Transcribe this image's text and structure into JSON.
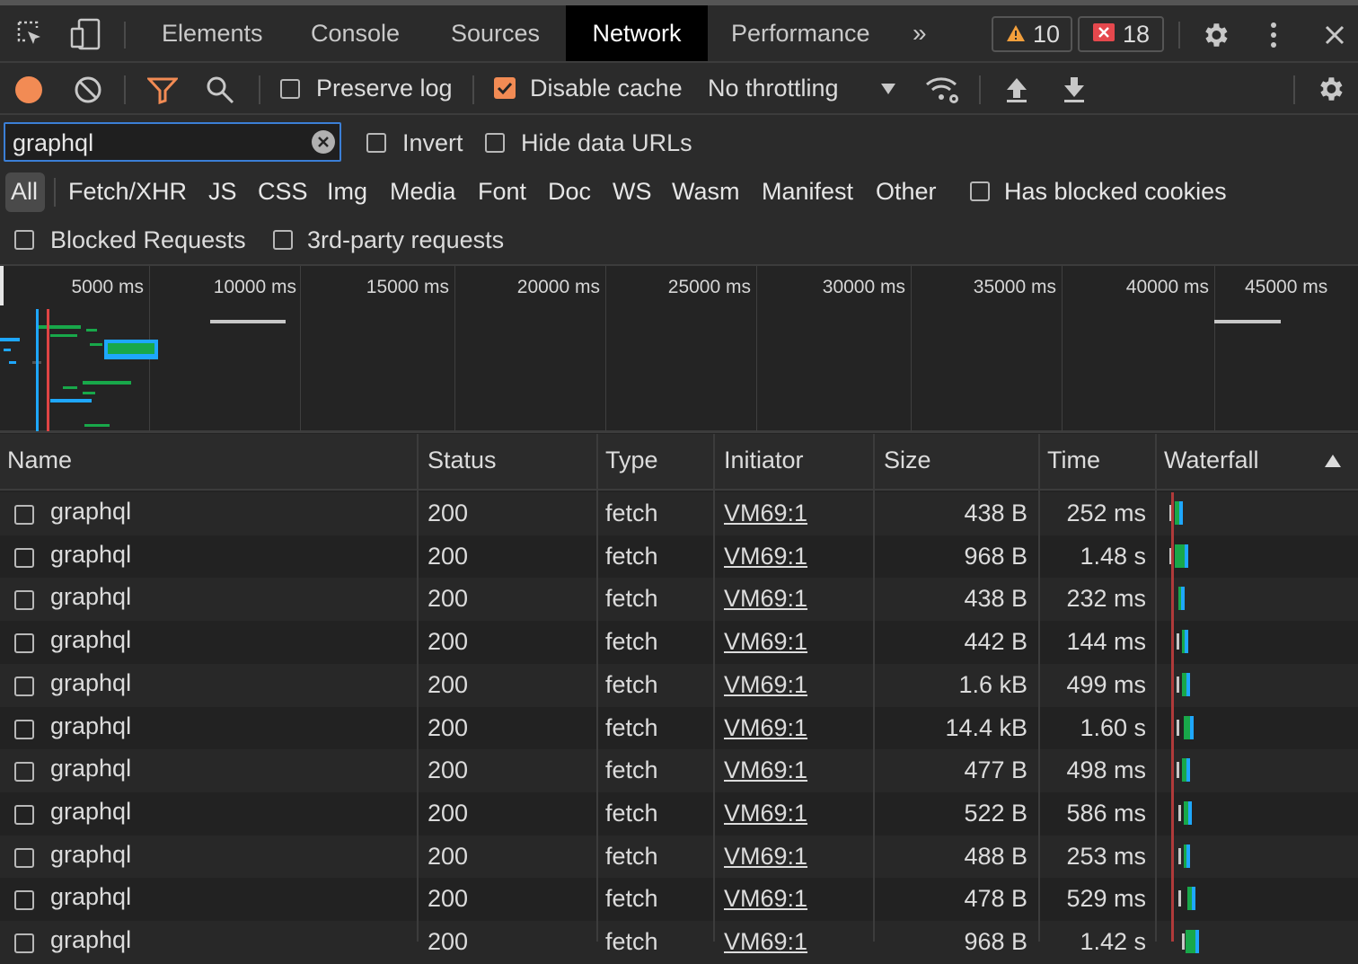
{
  "tabs": [
    "Elements",
    "Console",
    "Sources",
    "Network",
    "Performance"
  ],
  "active_tab": "Network",
  "warnings_count": "10",
  "errors_count": "18",
  "toolbar": {
    "preserve_log": "Preserve log",
    "disable_cache": "Disable cache",
    "throttling": "No throttling"
  },
  "filter": {
    "value": "graphql",
    "invert": "Invert",
    "hide_data_urls": "Hide data URLs",
    "types": [
      "All",
      "Fetch/XHR",
      "JS",
      "CSS",
      "Img",
      "Media",
      "Font",
      "Doc",
      "WS",
      "Wasm",
      "Manifest",
      "Other"
    ],
    "has_blocked_cookies": "Has blocked cookies",
    "blocked_requests": "Blocked Requests",
    "third_party": "3rd-party requests"
  },
  "overview_ticks": [
    "5000 ms",
    "10000 ms",
    "15000 ms",
    "20000 ms",
    "25000 ms",
    "30000 ms",
    "35000 ms",
    "40000 ms",
    "45000 ms"
  ],
  "table": {
    "columns": [
      "Name",
      "Status",
      "Type",
      "Initiator",
      "Size",
      "Time",
      "Waterfall"
    ],
    "rows": [
      {
        "name": "graphql",
        "status": "200",
        "type": "fetch",
        "initiator": "VM69:1",
        "size": "438 B",
        "time": "252 ms"
      },
      {
        "name": "graphql",
        "status": "200",
        "type": "fetch",
        "initiator": "VM69:1",
        "size": "968 B",
        "time": "1.48 s"
      },
      {
        "name": "graphql",
        "status": "200",
        "type": "fetch",
        "initiator": "VM69:1",
        "size": "438 B",
        "time": "232 ms"
      },
      {
        "name": "graphql",
        "status": "200",
        "type": "fetch",
        "initiator": "VM69:1",
        "size": "442 B",
        "time": "144 ms"
      },
      {
        "name": "graphql",
        "status": "200",
        "type": "fetch",
        "initiator": "VM69:1",
        "size": "1.6 kB",
        "time": "499 ms"
      },
      {
        "name": "graphql",
        "status": "200",
        "type": "fetch",
        "initiator": "VM69:1",
        "size": "14.4 kB",
        "time": "1.60 s"
      },
      {
        "name": "graphql",
        "status": "200",
        "type": "fetch",
        "initiator": "VM69:1",
        "size": "477 B",
        "time": "498 ms"
      },
      {
        "name": "graphql",
        "status": "200",
        "type": "fetch",
        "initiator": "VM69:1",
        "size": "522 B",
        "time": "586 ms"
      },
      {
        "name": "graphql",
        "status": "200",
        "type": "fetch",
        "initiator": "VM69:1",
        "size": "488 B",
        "time": "253 ms"
      },
      {
        "name": "graphql",
        "status": "200",
        "type": "fetch",
        "initiator": "VM69:1",
        "size": "478 B",
        "time": "529 ms"
      },
      {
        "name": "graphql",
        "status": "200",
        "type": "fetch",
        "initiator": "VM69:1",
        "size": "968 B",
        "time": "1.42 s"
      }
    ]
  },
  "colors": {
    "record": "#f28b54",
    "accent_orange": "#f28b54",
    "waterfall_blue": "#1ea7fd",
    "waterfall_green": "#18a84a",
    "red_line": "#e04444"
  }
}
